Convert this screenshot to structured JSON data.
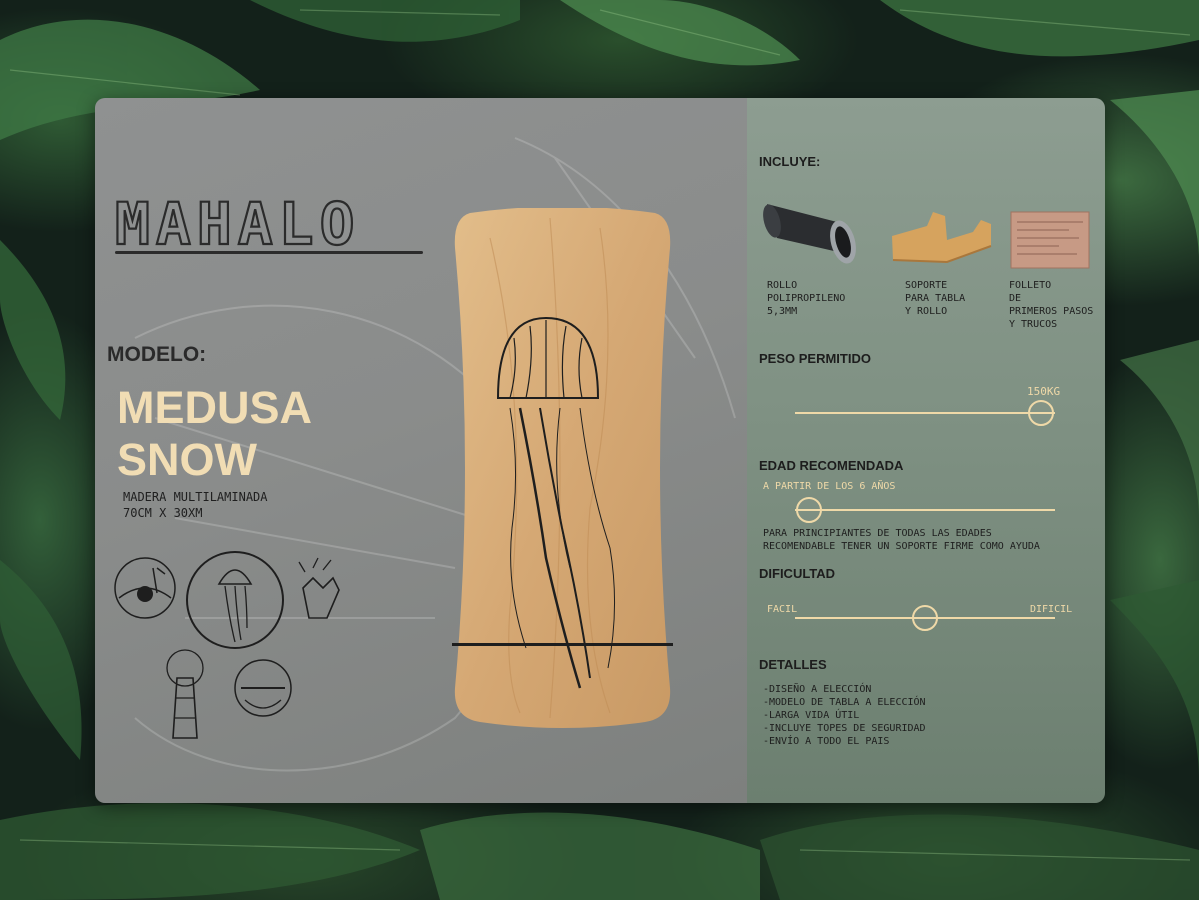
{
  "brand": {
    "logo_text": "MAHALO"
  },
  "model": {
    "label": "MODELO:",
    "name_line1": "MEDUSA",
    "name_line2": "SNOW",
    "spec_line1": "MADERA MULTILAMINADA",
    "spec_line2": "70CM X 30XM"
  },
  "includes": {
    "title": "INCLUYE:",
    "items": [
      {
        "line1": "ROLLO",
        "line2": "POLIPROPILENO",
        "line3": "5,3MM",
        "line4": ""
      },
      {
        "line1": "SOPORTE",
        "line2": "PARA TABLA",
        "line3": "Y ROLLO",
        "line4": ""
      },
      {
        "line1": "FOLLETO",
        "line2": "DE",
        "line3": "PRIMEROS PASOS",
        "line4": "Y TRUCOS"
      }
    ]
  },
  "weight": {
    "title": "PESO PERMITIDO",
    "value_label": "150KG",
    "level": 1.0
  },
  "age": {
    "title": "EDAD RECOMENDADA",
    "value_label": "A PARTIR DE LOS 6 AÑOS",
    "level": 0.0,
    "note_line1": "PARA PRINCIPIANTES DE TODAS LAS EDADES",
    "note_line2": "RECOMENDABLE TENER UN SOPORTE FIRME COMO AYUDA"
  },
  "difficulty": {
    "title": "DIFICULTAD",
    "min_label": "FACIL",
    "max_label": "DIFICIL",
    "level": 0.5
  },
  "details": {
    "title": "DETALLES",
    "items": [
      "-DISEÑO A ELECCIÓN",
      "-MODELO DE TABLA A ELECCIÓN",
      "-LARGA VIDA ÚTIL",
      "-INCLUYE TOPES DE SEGURIDAD",
      "-ENVÍO A TODO EL PAIS"
    ]
  },
  "colors": {
    "accent": "#efd9a8",
    "wood": "#d9b27e",
    "ink": "#1e1e1e"
  }
}
